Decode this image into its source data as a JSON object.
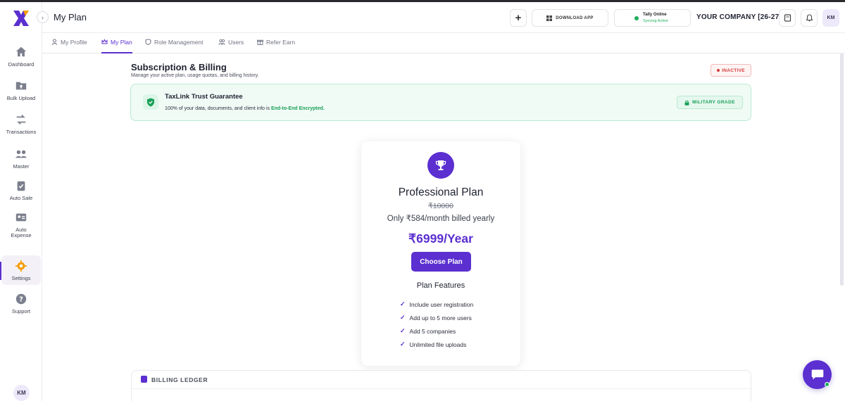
{
  "header": {
    "title": "My Plan",
    "download_label": "DOWNLOAD APP",
    "tally_status": "Tally Online",
    "tally_sub": "Syncing Active",
    "company": "YOUR COMPANY [26-27]",
    "avatar": "KM"
  },
  "sidebar": {
    "items": [
      {
        "label": "Dashboard",
        "icon": "home-icon"
      },
      {
        "label": "Bulk Upload",
        "icon": "upload-icon"
      },
      {
        "label": "Transactions",
        "icon": "transfer-icon"
      },
      {
        "label": "Master",
        "icon": "group-icon"
      },
      {
        "label": "Auto Sale",
        "icon": "clipboard-check-icon"
      },
      {
        "label": "Auto\nExpense",
        "icon": "id-card-icon"
      },
      {
        "label": "Settings",
        "icon": "gear-icon"
      },
      {
        "label": "Support",
        "icon": "help-icon"
      }
    ],
    "avatar": "KM",
    "accent": "#5b2fd0",
    "icon_color": "#7b7f8d",
    "active_icon_color": "#f59e0b"
  },
  "tabs": [
    {
      "label": "My Profile",
      "icon": "user-icon"
    },
    {
      "label": "My Plan",
      "icon": "crown-icon"
    },
    {
      "label": "Role Management",
      "icon": "shield-icon"
    },
    {
      "label": "Users",
      "icon": "users-icon"
    },
    {
      "label": "Refer Earn",
      "icon": "gift-icon"
    }
  ],
  "subscription": {
    "title": "Subscription & Billing",
    "description": "Manage your active plan, usage quotas, and billing history.",
    "status": "INACTIVE"
  },
  "trust": {
    "title": "TaxLink Trust Guarantee",
    "desc_prefix": "100% of your data, documents, and client info is ",
    "desc_highlight": "End-to-End Encrypted.",
    "badge": "MILITARY GRADE"
  },
  "plan": {
    "name": "Professional Plan",
    "old_price": "₹10000",
    "monthly": "Only ₹584/month billed yearly",
    "price": "₹6999/Year",
    "cta": "Choose Plan",
    "features_title": "Plan Features",
    "features": [
      "Include user registration",
      "Add up to 5 more users",
      "Add 5 companies",
      "Unlimited file uploads"
    ]
  },
  "ledger": {
    "title": "BILLING LEDGER"
  }
}
